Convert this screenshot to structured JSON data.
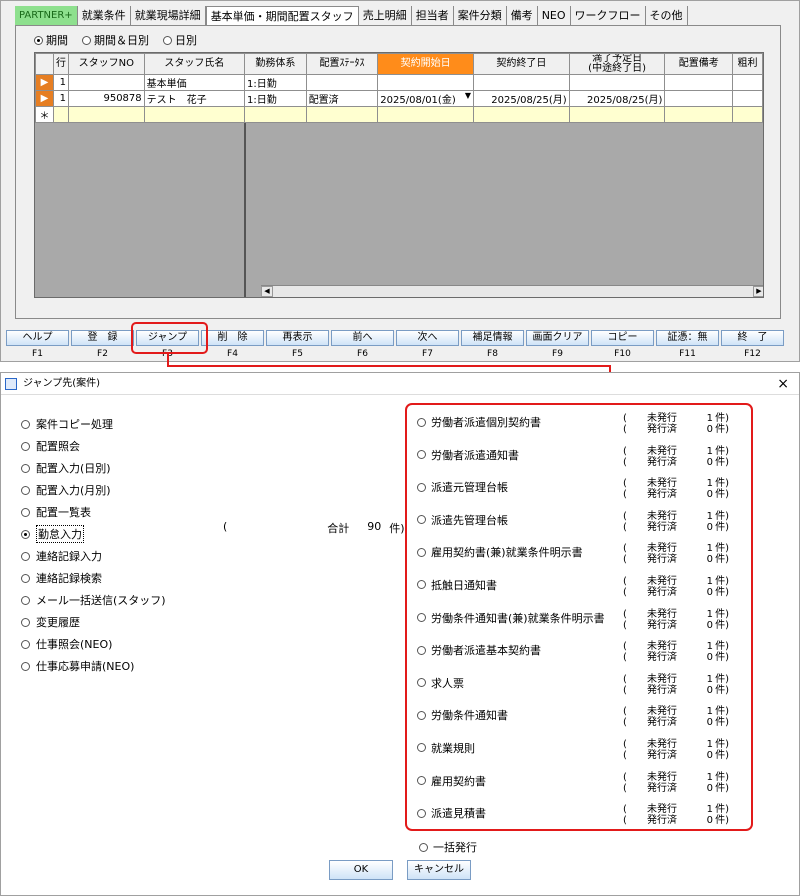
{
  "tabs": [
    "PARTNER+",
    "就業条件",
    "就業現場詳細",
    "基本単価・期間配置スタッフ",
    "売上明細",
    "担当者",
    "案件分類",
    "備考",
    "NEO",
    "ワークフロー",
    "その他"
  ],
  "period_options": [
    "期間",
    "期間＆日別",
    "日別"
  ],
  "grid": {
    "headers": [
      "行",
      "スタッフNO",
      "スタッフ氏名",
      "勤務体系",
      "配置ｽﾃｰﾀｽ",
      "契約開始日",
      "契約終了日",
      "満了予定日\n(中途終了日)",
      "配置備考",
      "粗利"
    ],
    "rows": [
      [
        "1",
        "",
        "基本単価",
        "1:日勤",
        "",
        "",
        "",
        "",
        "",
        ""
      ],
      [
        "1",
        "950878",
        "テスト　花子",
        "1:日勤",
        "配置済",
        "2025/08/01(金)",
        "2025/08/25(月)",
        "2025/08/25(月)",
        "",
        ""
      ]
    ],
    "new_row_marker": "＊"
  },
  "fkeys": [
    {
      "label": "ヘルプ",
      "key": "F1"
    },
    {
      "label": "登　録",
      "key": "F2"
    },
    {
      "label": "ジャンプ",
      "key": "F3"
    },
    {
      "label": "削　除",
      "key": "F4"
    },
    {
      "label": "再表示",
      "key": "F5"
    },
    {
      "label": "前へ",
      "key": "F6"
    },
    {
      "label": "次へ",
      "key": "F7"
    },
    {
      "label": "補足情報",
      "key": "F8"
    },
    {
      "label": "画面クリア",
      "key": "F9"
    },
    {
      "label": "コピー",
      "key": "F10"
    },
    {
      "label": "証憑：無",
      "key": "F11"
    },
    {
      "label": "終　了",
      "key": "F12"
    }
  ],
  "dialog": {
    "title": "ジャンプ先(案件)",
    "close": "×",
    "left_items": [
      "案件コピー処理",
      "配置照会",
      "配置入力(日別)",
      "配置入力(月別)",
      "配置一覧表",
      "勤怠入力",
      "連絡記録入力",
      "連絡記録検索",
      "メール一括送信(スタッフ)",
      "変更履歴",
      "仕事照会(NEO)",
      "仕事応募申請(NEO)"
    ],
    "selected_index": 5,
    "total": {
      "open": "(",
      "label": "合計",
      "value": "90",
      "unit": "件)"
    },
    "status_labels": {
      "unissued": "未発行",
      "issued": "発行済",
      "open": "(",
      "unit": "件)"
    },
    "documents": [
      {
        "name": "労働者派遣個別契約書",
        "unissued": "1",
        "issued": "0"
      },
      {
        "name": "労働者派遣通知書",
        "unissued": "1",
        "issued": "0"
      },
      {
        "name": "派遣元管理台帳",
        "unissued": "1",
        "issued": "0"
      },
      {
        "name": "派遣先管理台帳",
        "unissued": "1",
        "issued": "0"
      },
      {
        "name": "雇用契約書(兼)就業条件明示書",
        "unissued": "1",
        "issued": "0"
      },
      {
        "name": "抵触日通知書",
        "unissued": "1",
        "issued": "0"
      },
      {
        "name": "労働条件通知書(兼)就業条件明示書",
        "unissued": "1",
        "issued": "0"
      },
      {
        "name": "労働者派遣基本契約書",
        "unissued": "1",
        "issued": "0"
      },
      {
        "name": "求人票",
        "unissued": "1",
        "issued": "0"
      },
      {
        "name": "労働条件通知書",
        "unissued": "1",
        "issued": "0"
      },
      {
        "name": "就業規則",
        "unissued": "1",
        "issued": "0"
      },
      {
        "name": "雇用契約書",
        "unissued": "1",
        "issued": "0"
      },
      {
        "name": "派遣見積書",
        "unissued": "1",
        "issued": "0"
      }
    ],
    "bulk_issue": "一括発行",
    "ok": "OK",
    "cancel": "キャンセル"
  },
  "colors": {
    "highlight": "#e21a1a",
    "header_active": "#ff8c1a",
    "partner_tab": "#8ee08e"
  }
}
